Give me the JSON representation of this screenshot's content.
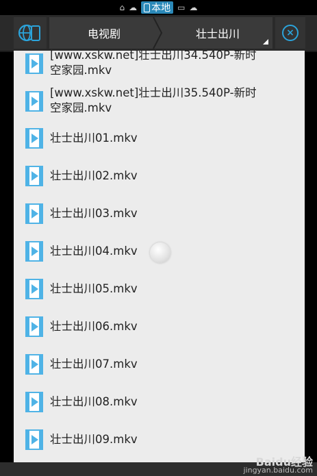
{
  "statusbar": {
    "local_label": "本地"
  },
  "breadcrumb": {
    "first": "电视剧",
    "second": "壮士出川"
  },
  "files": [
    {
      "name": "[www.xskw.net]壮士出川34.540P-新时\n空家园.mkv"
    },
    {
      "name": "[www.xskw.net]壮士出川35.540P-新时\n空家园.mkv"
    },
    {
      "name": "壮士出川01.mkv"
    },
    {
      "name": "壮士出川02.mkv"
    },
    {
      "name": "壮士出川03.mkv"
    },
    {
      "name": "壮士出川04.mkv"
    },
    {
      "name": "壮士出川05.mkv"
    },
    {
      "name": "壮士出川06.mkv"
    },
    {
      "name": "壮士出川07.mkv"
    },
    {
      "name": "壮士出川08.mkv"
    },
    {
      "name": "壮士出川09.mkv"
    }
  ],
  "watermark": {
    "logo": "Baidu经验",
    "url": "jingyan.baidu.com"
  },
  "colors": {
    "accent": "#2ba4dc",
    "list_bg": "#ececec",
    "icon_fill": "#4fb3e6"
  }
}
